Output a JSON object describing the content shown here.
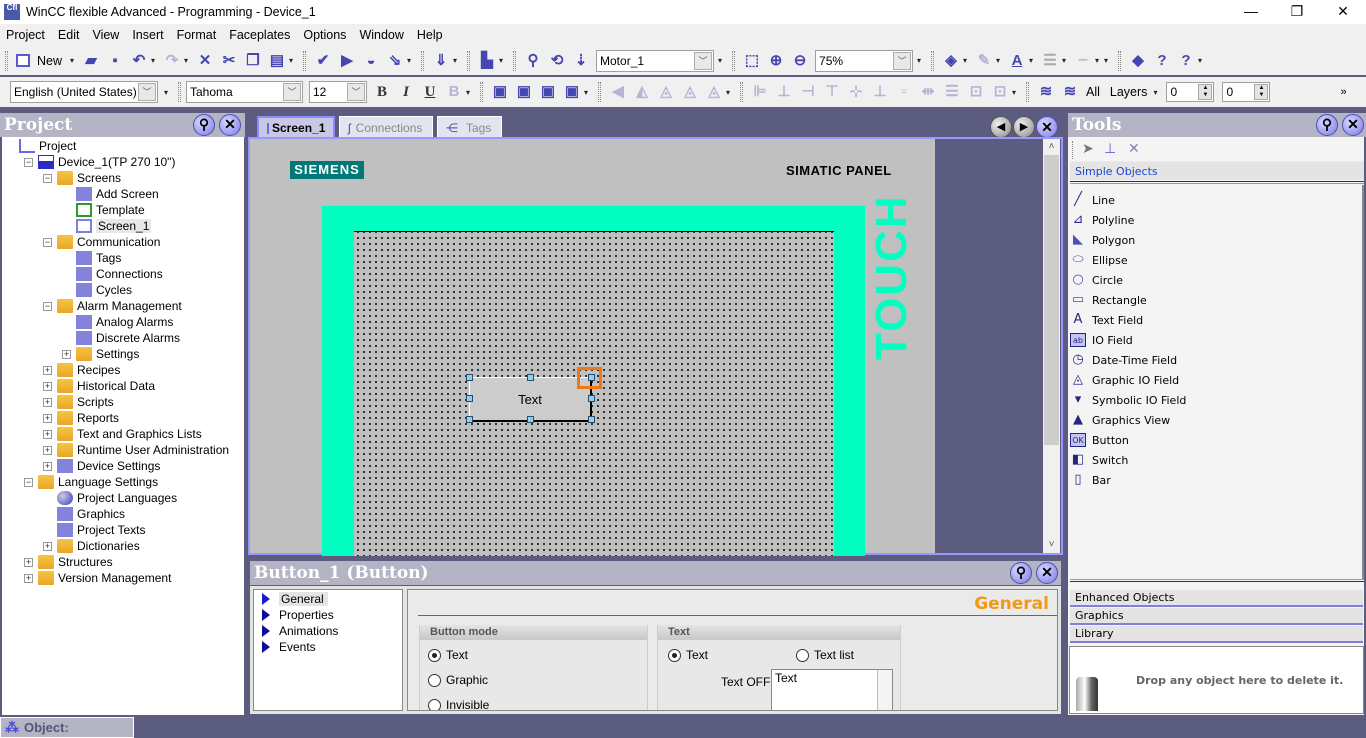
{
  "window": {
    "title": "WinCC flexible Advanced - Programming - Device_1",
    "app_icon_text": "Cfl",
    "minimize_glyph": "—",
    "restore_glyph": "❐",
    "close_glyph": "✕"
  },
  "menu": [
    "Project",
    "Edit",
    "View",
    "Insert",
    "Format",
    "Faceplates",
    "Options",
    "Window",
    "Help"
  ],
  "toolbar": {
    "new_label": "New",
    "object_combo": "Motor_1",
    "zoom_combo": "75%",
    "language_combo": "English (United States)",
    "font_combo": "Tahoma",
    "size_combo": "12",
    "bold": "B",
    "italic": "I",
    "underline": "U",
    "all_label": "All",
    "layers_label": "Layers",
    "spin1_value": "0",
    "spin2_value": "0",
    "overflow": "»"
  },
  "project_panel": {
    "title": "Project",
    "tree": [
      {
        "label": "Project",
        "level": 0
      },
      {
        "label": "Device_1(TP 270 10\")",
        "level": 1,
        "expanded": true
      },
      {
        "label": "Screens",
        "level": 2,
        "expanded": true
      },
      {
        "label": "Add Screen",
        "level": 3
      },
      {
        "label": "Template",
        "level": 3
      },
      {
        "label": "Screen_1",
        "level": 3,
        "selected": true
      },
      {
        "label": "Communication",
        "level": 2,
        "expanded": true
      },
      {
        "label": "Tags",
        "level": 3
      },
      {
        "label": "Connections",
        "level": 3
      },
      {
        "label": "Cycles",
        "level": 3
      },
      {
        "label": "Alarm Management",
        "level": 2,
        "expanded": true
      },
      {
        "label": "Analog Alarms",
        "level": 3
      },
      {
        "label": "Discrete Alarms",
        "level": 3
      },
      {
        "label": "Settings",
        "level": 3,
        "expanded": false
      },
      {
        "label": "Recipes",
        "level": 2,
        "expanded": false
      },
      {
        "label": "Historical Data",
        "level": 2,
        "expanded": false
      },
      {
        "label": "Scripts",
        "level": 2,
        "expanded": false
      },
      {
        "label": "Reports",
        "level": 2,
        "expanded": false
      },
      {
        "label": "Text and Graphics Lists",
        "level": 2,
        "expanded": false
      },
      {
        "label": "Runtime User Administration",
        "level": 2,
        "expanded": false
      },
      {
        "label": "Device Settings",
        "level": 2,
        "expanded": false
      },
      {
        "label": "Language Settings",
        "level": 1,
        "expanded": true
      },
      {
        "label": "Project Languages",
        "level": 2
      },
      {
        "label": "Graphics",
        "level": 2
      },
      {
        "label": "Project Texts",
        "level": 2
      },
      {
        "label": "Dictionaries",
        "level": 2,
        "expanded": false
      },
      {
        "label": "Structures",
        "level": 1,
        "expanded": false
      },
      {
        "label": "Version Management",
        "level": 1,
        "expanded": false
      }
    ]
  },
  "editor": {
    "tabs": [
      {
        "label": "Screen_1",
        "active": true
      },
      {
        "label": "Connections",
        "active": false
      },
      {
        "label": "Tags",
        "active": false
      }
    ],
    "panel": {
      "brand": "SIEMENS",
      "model": "SIMATIC PANEL",
      "side_text": "TOUCH"
    },
    "button_object_text": "Text",
    "colors": {
      "frame": "#00ffc0",
      "selection": "#f07810"
    }
  },
  "properties": {
    "title": "Button_1 (Button)",
    "nav": [
      {
        "label": "General",
        "active": true
      },
      {
        "label": "Properties",
        "active": false
      },
      {
        "label": "Animations",
        "active": false
      },
      {
        "label": "Events",
        "active": false
      }
    ],
    "section_title": "General",
    "button_mode": {
      "title": "Button mode",
      "options": [
        {
          "label": "Text",
          "checked": true
        },
        {
          "label": "Graphic",
          "checked": false
        },
        {
          "label": "Invisible",
          "checked": false
        }
      ]
    },
    "text_group": {
      "title": "Text",
      "option_text": "Text",
      "option_text_checked": true,
      "option_textlist": "Text list",
      "option_textlist_checked": false,
      "text_off_label": "Text OFF",
      "text_off_value": "Text"
    }
  },
  "tools_panel": {
    "title": "Tools",
    "active_section": "Simple Objects",
    "simple_objects": [
      "Line",
      "Polyline",
      "Polygon",
      "Ellipse",
      "Circle",
      "Rectangle",
      "Text Field",
      "IO Field",
      "Date-Time Field",
      "Graphic IO Field",
      "Symbolic IO Field",
      "Graphics View",
      "Button",
      "Switch",
      "Bar"
    ],
    "sections": [
      "Enhanced Objects",
      "Graphics",
      "Library"
    ],
    "trash_text": "Drop any object here to delete it."
  },
  "status": {
    "object_label": "Object:"
  }
}
